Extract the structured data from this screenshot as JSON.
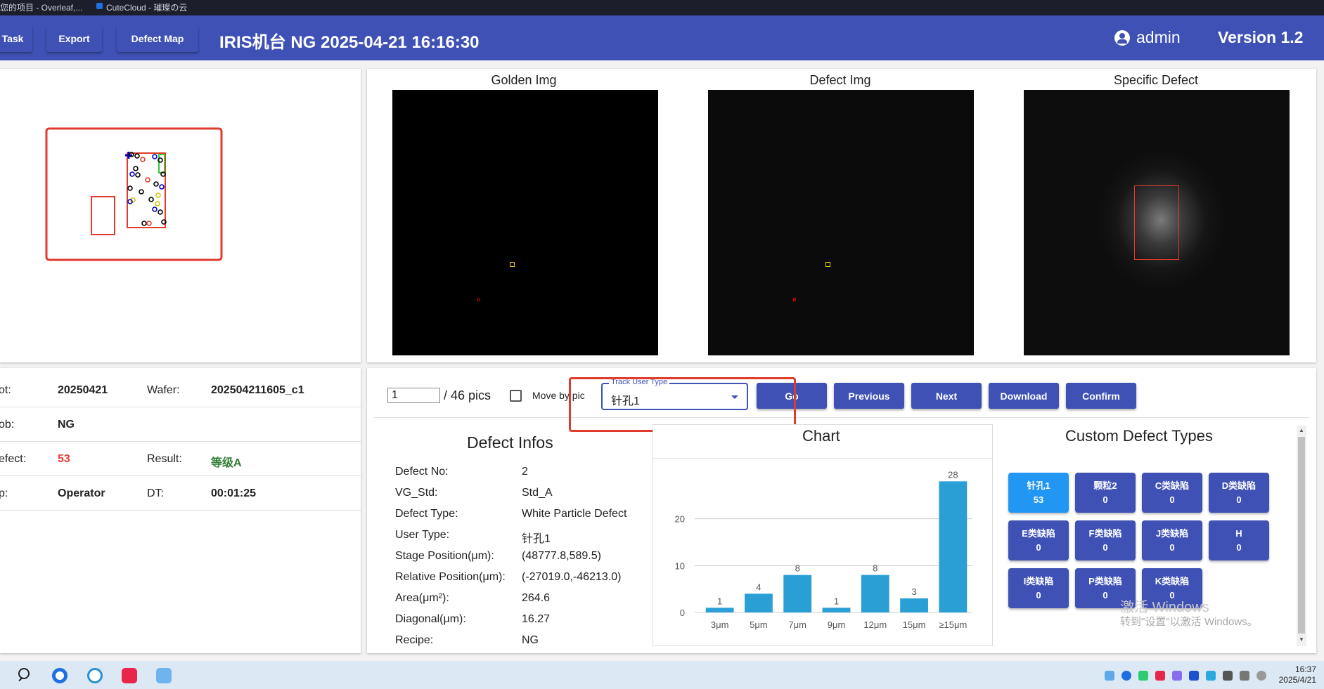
{
  "browser": {
    "tab1": "您的项目 - Overleaf,...",
    "tab2": "CuteCloud - 璀璨の云"
  },
  "header": {
    "btn_task": "Task",
    "btn_export": "Export",
    "btn_defect_map": "Defect Map",
    "title": "IRIS机台   NG   2025-04-21 16:16:30",
    "user": "admin",
    "version": "Version 1.2",
    "color": "#3f51b5"
  },
  "images": {
    "golden": "Golden Img",
    "defect": "Defect Img",
    "specific": "Specific Defect"
  },
  "info": {
    "rows": [
      {
        "l1": "ot:",
        "v1": "20250421",
        "l2": "Wafer:",
        "v2": "202504211605_c1"
      },
      {
        "l1": "ob:",
        "v1": "NG",
        "l2": "",
        "v2": ""
      },
      {
        "l1": "efect:",
        "v1": "53",
        "l2": "Result:",
        "v2": "等级A"
      },
      {
        "l1": "p:",
        "v1": "Operator",
        "l2": "DT:",
        "v2": "00:01:25"
      }
    ],
    "defect_color": "#e53935",
    "result_color": "#2e7d32"
  },
  "controls": {
    "page_value": "1",
    "page_total": "/ 46 pics",
    "move_label": "Move by pic",
    "track_legend": "Track User Type",
    "track_value": "针孔1",
    "btn_go": "Go",
    "btn_previous": "Previous",
    "btn_next": "Next",
    "btn_download": "Download",
    "btn_confirm": "Confirm"
  },
  "defect_infos": {
    "title": "Defect Infos",
    "rows": [
      {
        "k": "Defect No:",
        "v": "2"
      },
      {
        "k": "VG_Std:",
        "v": "Std_A"
      },
      {
        "k": "Defect Type:",
        "v": "White Particle Defect"
      },
      {
        "k": "User Type:",
        "v": "针孔1"
      },
      {
        "k": "Stage Position(μm):",
        "v": "(48777.8,589.5)"
      },
      {
        "k": "Relative Position(μm):",
        "v": "(-27019.0,-46213.0)"
      },
      {
        "k": "Area(μm²):",
        "v": "264.6"
      },
      {
        "k": "Diagonal(μm):",
        "v": "16.27"
      },
      {
        "k": "Recipe:",
        "v": "NG"
      }
    ]
  },
  "chart_data": {
    "type": "bar",
    "title": "Chart",
    "categories": [
      "3μm",
      "5μm",
      "7μm",
      "9μm",
      "12μm",
      "15μm",
      "≥15μm"
    ],
    "values": [
      1,
      4,
      8,
      1,
      8,
      3,
      28
    ],
    "yticks": [
      0,
      10,
      20
    ],
    "ylim": [
      0,
      30
    ],
    "grid": true,
    "bar_color": "#2a9fd6"
  },
  "custom_types": {
    "title": "Custom Defect Types",
    "items": [
      {
        "name": "针孔1",
        "count": "53",
        "active": true
      },
      {
        "name": "颗粒2",
        "count": "0"
      },
      {
        "name": "C类缺陷",
        "count": "0"
      },
      {
        "name": "D类缺陷",
        "count": "0"
      },
      {
        "name": "E类缺陷",
        "count": "0"
      },
      {
        "name": "F类缺陷",
        "count": "0"
      },
      {
        "name": "J类缺陷",
        "count": "0"
      },
      {
        "name": "H",
        "count": "0"
      },
      {
        "name": "I类缺陷",
        "count": "0"
      },
      {
        "name": "P类缺陷",
        "count": "0"
      },
      {
        "name": "K类缺陷",
        "count": "0"
      }
    ]
  },
  "watermark": {
    "line1": "激活 Windows",
    "line2": "转到\"设置\"以激活 Windows。"
  },
  "taskbar": {
    "time": "16:37",
    "date": "2025/4/21"
  }
}
